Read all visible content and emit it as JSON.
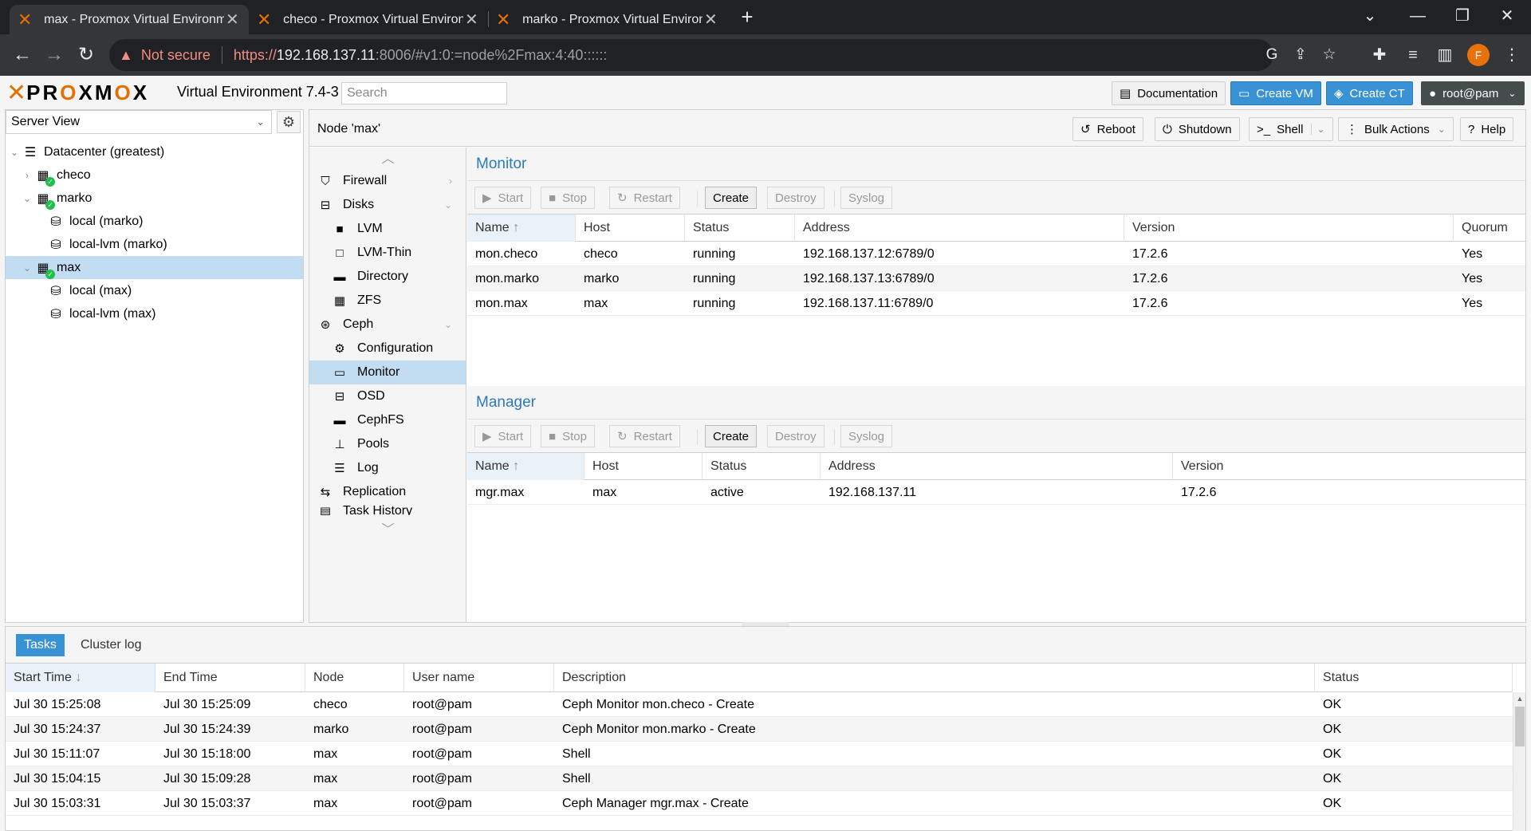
{
  "browser": {
    "tabs": [
      {
        "title": "max - Proxmox Virtual Environme",
        "active": true
      },
      {
        "title": "checo - Proxmox Virtual Environ",
        "active": false
      },
      {
        "title": "marko - Proxmox Virtual Environ",
        "active": false
      }
    ],
    "new_tab": "+",
    "nav": {
      "back": "←",
      "forward": "→",
      "reload": "↻"
    },
    "address": {
      "security_label": "Not secure",
      "scheme": "https://",
      "host": "192.168.137.11",
      "rest": ":8006/#v1:0:=node%2Fmax:4:40::::::"
    },
    "profile_initial": "F",
    "window": {
      "minimize": "—",
      "maximize": "❐",
      "close": "✕",
      "tabsearch": "⌄"
    }
  },
  "header": {
    "logo": {
      "x": "✕",
      "text_pre": "PR",
      "text_o1": "O",
      "text_mid": "XM",
      "text_o2": "O",
      "text_post": "X"
    },
    "title": "Virtual Environment 7.4-3",
    "search_placeholder": "Search",
    "buttons": {
      "documentation": "Documentation",
      "create_vm": "Create VM",
      "create_ct": "Create CT",
      "user": "root@pam"
    }
  },
  "tree": {
    "view": "Server View",
    "items": [
      {
        "label": "Datacenter (greatest)",
        "level": 0,
        "type": "datacenter",
        "expanded": true
      },
      {
        "label": "checo",
        "level": 1,
        "type": "node",
        "expanded": false
      },
      {
        "label": "marko",
        "level": 1,
        "type": "node",
        "expanded": true
      },
      {
        "label": "local (marko)",
        "level": 2,
        "type": "storage"
      },
      {
        "label": "local-lvm (marko)",
        "level": 2,
        "type": "storage"
      },
      {
        "label": "max",
        "level": 1,
        "type": "node",
        "expanded": true,
        "selected": true
      },
      {
        "label": "local (max)",
        "level": 2,
        "type": "storage"
      },
      {
        "label": "local-lvm (max)",
        "level": 2,
        "type": "storage"
      }
    ]
  },
  "node": {
    "title": "Node 'max'",
    "buttons": {
      "reboot": "Reboot",
      "shutdown": "Shutdown",
      "shell": "Shell",
      "bulk": "Bulk Actions",
      "help": "Help"
    }
  },
  "subnav": {
    "items": [
      {
        "label": "Firewall",
        "icon": "shield-icon",
        "sub": false
      },
      {
        "label": "Disks",
        "icon": "disk-icon",
        "sub": false,
        "expanded": true
      },
      {
        "label": "LVM",
        "icon": "square-icon",
        "sub": true
      },
      {
        "label": "LVM-Thin",
        "icon": "square-outline-icon",
        "sub": true
      },
      {
        "label": "Directory",
        "icon": "folder-icon",
        "sub": true
      },
      {
        "label": "ZFS",
        "icon": "grid-icon",
        "sub": true
      },
      {
        "label": "Ceph",
        "icon": "ceph-icon",
        "sub": false,
        "expanded": true
      },
      {
        "label": "Configuration",
        "icon": "gear-icon",
        "sub": true
      },
      {
        "label": "Monitor",
        "icon": "monitor-icon",
        "sub": true,
        "selected": true
      },
      {
        "label": "OSD",
        "icon": "hdd-icon",
        "sub": true
      },
      {
        "label": "CephFS",
        "icon": "folder-icon",
        "sub": true
      },
      {
        "label": "Pools",
        "icon": "sitemap-icon",
        "sub": true
      },
      {
        "label": "Log",
        "icon": "list-icon",
        "sub": true
      },
      {
        "label": "Replication",
        "icon": "retweet-icon",
        "sub": false
      },
      {
        "label": "Task History",
        "icon": "list-alt-icon",
        "sub": false
      }
    ]
  },
  "monitor": {
    "title": "Monitor",
    "toolbar": {
      "start": "Start",
      "stop": "Stop",
      "restart": "Restart",
      "create": "Create",
      "destroy": "Destroy",
      "syslog": "Syslog"
    },
    "columns": [
      "Name",
      "Host",
      "Status",
      "Address",
      "Version",
      "Quorum"
    ],
    "rows": [
      [
        "mon.checo",
        "checo",
        "running",
        "192.168.137.12:6789/0",
        "17.2.6",
        "Yes"
      ],
      [
        "mon.marko",
        "marko",
        "running",
        "192.168.137.13:6789/0",
        "17.2.6",
        "Yes"
      ],
      [
        "mon.max",
        "max",
        "running",
        "192.168.137.11:6789/0",
        "17.2.6",
        "Yes"
      ]
    ]
  },
  "manager": {
    "title": "Manager",
    "toolbar": {
      "start": "Start",
      "stop": "Stop",
      "restart": "Restart",
      "create": "Create",
      "destroy": "Destroy",
      "syslog": "Syslog"
    },
    "columns": [
      "Name",
      "Host",
      "Status",
      "Address",
      "Version"
    ],
    "rows": [
      [
        "mgr.max",
        "max",
        "active",
        "192.168.137.11",
        "17.2.6"
      ]
    ]
  },
  "tasks": {
    "tabs": [
      "Tasks",
      "Cluster log"
    ],
    "columns": [
      "Start Time",
      "End Time",
      "Node",
      "User name",
      "Description",
      "Status"
    ],
    "rows": [
      [
        "Jul 30 15:25:08",
        "Jul 30 15:25:09",
        "checo",
        "root@pam",
        "Ceph Monitor mon.checo - Create",
        "OK"
      ],
      [
        "Jul 30 15:24:37",
        "Jul 30 15:24:39",
        "marko",
        "root@pam",
        "Ceph Monitor mon.marko - Create",
        "OK"
      ],
      [
        "Jul 30 15:11:07",
        "Jul 30 15:18:00",
        "max",
        "root@pam",
        "Shell",
        "OK"
      ],
      [
        "Jul 30 15:04:15",
        "Jul 30 15:09:28",
        "max",
        "root@pam",
        "Shell",
        "OK"
      ],
      [
        "Jul 30 15:03:31",
        "Jul 30 15:03:37",
        "max",
        "root@pam",
        "Ceph Manager mgr.max - Create",
        "OK"
      ]
    ]
  },
  "colors": {
    "accent": "#3892d4",
    "brand_orange": "#e57000",
    "selection": "#c2ddf2",
    "ok_green": "#21bf4b"
  }
}
